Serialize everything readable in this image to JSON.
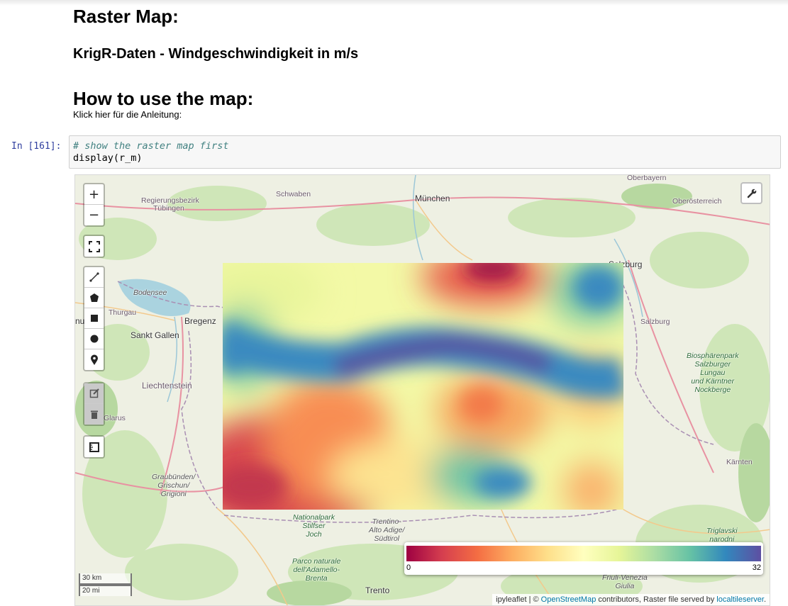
{
  "headings": {
    "raster_map": "Raster Map:",
    "dataset": "KrigR-Daten - Windgeschwindigkeit in m/s",
    "how_to": "How to use the map:",
    "instructions": "Klick hier für die Anleitung:"
  },
  "cell": {
    "prompt": "In [161]:",
    "comment": "# show the raster map first",
    "code": "display(r_m)"
  },
  "map": {
    "controls": {
      "zoom_in": "+",
      "zoom_out": "−"
    },
    "place_labels": {
      "oberbayern": "Oberbayern",
      "regierungsbezirk": "Regierungsbezirk",
      "tuebingen": "Tübingen",
      "schwaben": "Schwaben",
      "muenchen": "München",
      "oberoesterreich": "Oberösterreich",
      "salzburg1": "Salzburg",
      "bodensee": "Bodensee",
      "thurgau": "Thurgau",
      "bregenz": "Bregenz",
      "sankt_gallen": "Sankt Gallen",
      "salzburg2": "Salzburg",
      "liechtenstein": "Liechtenstein",
      "glarus": "Glarus",
      "biosphaerenpark": "Biosphärenpark",
      "salzburger": "Salzburger",
      "lungau": "Lungau",
      "und_kaerntner": "und Kärntner",
      "nockberge": "Nockberge",
      "kaernten": "Kärnten",
      "graubuenden1": "Graubünden/",
      "graubuenden2": "Grischun/",
      "graubuenden3": "Grigioni",
      "nationalpark1": "Nationalpark",
      "nationalpark2": "Stilfser",
      "nationalpark3": "Joch",
      "trentino1": "Trentino-",
      "trentino2": "Alto Adige/",
      "trentino3": "Südtirol",
      "triglavski1": "Triglavski",
      "triglavski2": "narodni",
      "parco1": "Parco naturale",
      "parco2": "dell'Adamello-",
      "parco3": "Brenta",
      "trento": "Trento",
      "friuli1": "Friuli-Venezia",
      "friuli2": "Giulia",
      "nu": "nu"
    },
    "legend": {
      "min": "0",
      "max": "32",
      "colors": [
        "#9e0142",
        "#d53e4f",
        "#f46d43",
        "#fdae61",
        "#fee08b",
        "#ffffbf",
        "#e6f598",
        "#abdda4",
        "#66c2a5",
        "#3288bd",
        "#5e4fa2"
      ]
    },
    "scale": {
      "km": "30 km",
      "mi": "20 mi"
    },
    "attribution": {
      "prefix": "ipyleaflet | © ",
      "osm": "OpenStreetMap",
      "middle": " contributors, Raster file served by ",
      "server": "localtileserver",
      "suffix": "."
    }
  }
}
